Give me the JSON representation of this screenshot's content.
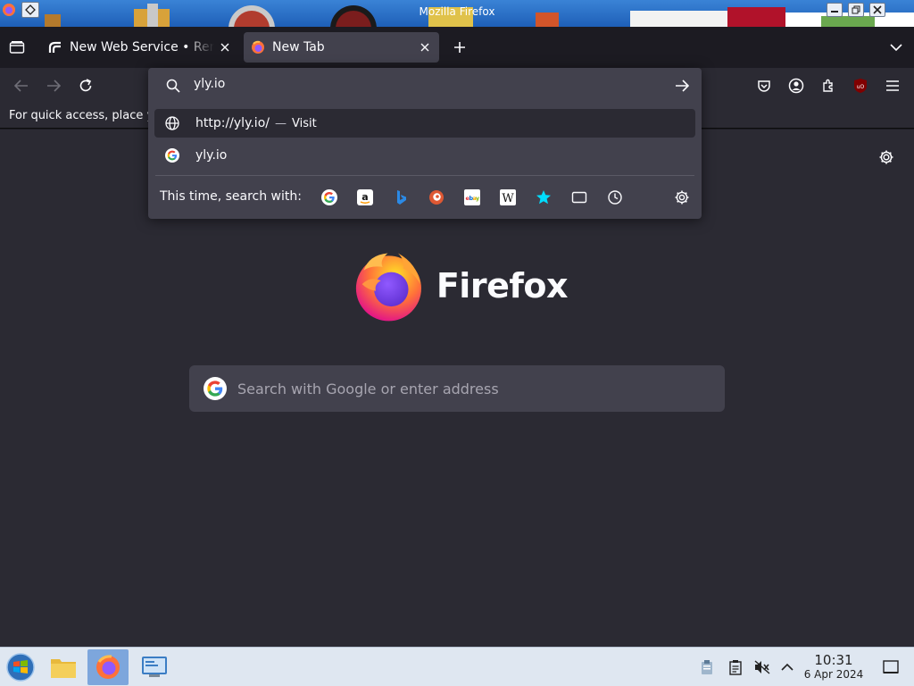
{
  "window": {
    "title": "Mozilla Firefox"
  },
  "tabs": [
    {
      "label": "New Web Service • Render",
      "active": false
    },
    {
      "label": "New Tab",
      "active": true
    }
  ],
  "urlbar": {
    "query": "yly.io",
    "results": [
      {
        "url": "http://yly.io/",
        "separator": "—",
        "action": "Visit",
        "icon": "globe-icon",
        "selected": true
      },
      {
        "text": "yly.io",
        "icon": "google-icon",
        "selected": false
      }
    ],
    "oneoff_label": "This time, search with:",
    "engines": [
      "google-icon",
      "amazon-icon",
      "bing-icon",
      "duckduckgo-icon",
      "ebay-icon",
      "wikipedia-icon",
      "bookmarks-icon",
      "tabs-icon",
      "history-icon"
    ]
  },
  "bookmarks_bar": {
    "message": "For quick access, place your bookmarks here on the bookmarks toolbar."
  },
  "newtab": {
    "brand": "Firefox",
    "search_placeholder": "Search with Google or enter address"
  },
  "taskbar": {
    "time": "10:31",
    "date": "6 Apr 2024"
  },
  "colors": {
    "accent_blue": "#0060df",
    "firefox_orange": "#ff7139",
    "firefox_purple": "#9059ff",
    "ublock_red": "#800000"
  }
}
